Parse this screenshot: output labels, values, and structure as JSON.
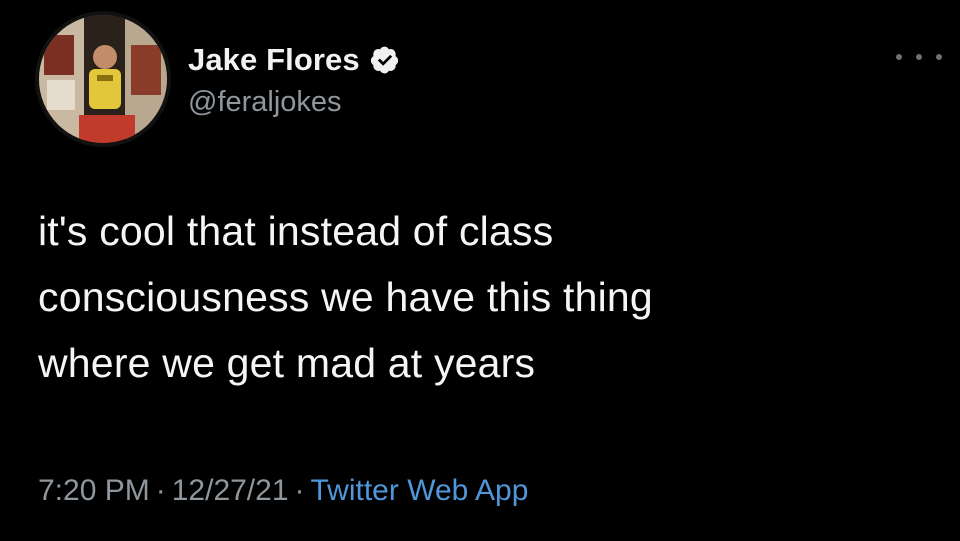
{
  "user": {
    "display_name": "Jake Flores",
    "handle": "@feraljokes",
    "verified": true,
    "avatar_icon": "profile-photo"
  },
  "tweet": {
    "lines": [
      "it's cool that instead of class",
      "consciousness we have this thing",
      "where we get mad at years"
    ]
  },
  "meta": {
    "time": "7:20 PM",
    "separator": "·",
    "date": "12/27/21",
    "source": "Twitter Web App"
  },
  "colors": {
    "background": "#000000",
    "text": "#f5f5f5",
    "secondary": "#8f969c",
    "link": "#4f97d8"
  }
}
